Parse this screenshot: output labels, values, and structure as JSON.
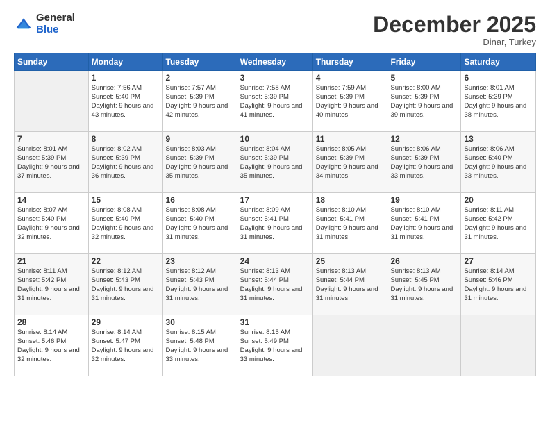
{
  "header": {
    "logo_general": "General",
    "logo_blue": "Blue",
    "month_title": "December 2025",
    "location": "Dinar, Turkey"
  },
  "weekdays": [
    "Sunday",
    "Monday",
    "Tuesday",
    "Wednesday",
    "Thursday",
    "Friday",
    "Saturday"
  ],
  "weeks": [
    [
      {
        "day": "",
        "sunrise": "",
        "sunset": "",
        "daylight": ""
      },
      {
        "day": "1",
        "sunrise": "7:56 AM",
        "sunset": "5:40 PM",
        "daylight": "9 hours and 43 minutes."
      },
      {
        "day": "2",
        "sunrise": "7:57 AM",
        "sunset": "5:39 PM",
        "daylight": "9 hours and 42 minutes."
      },
      {
        "day": "3",
        "sunrise": "7:58 AM",
        "sunset": "5:39 PM",
        "daylight": "9 hours and 41 minutes."
      },
      {
        "day": "4",
        "sunrise": "7:59 AM",
        "sunset": "5:39 PM",
        "daylight": "9 hours and 40 minutes."
      },
      {
        "day": "5",
        "sunrise": "8:00 AM",
        "sunset": "5:39 PM",
        "daylight": "9 hours and 39 minutes."
      },
      {
        "day": "6",
        "sunrise": "8:01 AM",
        "sunset": "5:39 PM",
        "daylight": "9 hours and 38 minutes."
      }
    ],
    [
      {
        "day": "7",
        "sunrise": "8:01 AM",
        "sunset": "5:39 PM",
        "daylight": "9 hours and 37 minutes."
      },
      {
        "day": "8",
        "sunrise": "8:02 AM",
        "sunset": "5:39 PM",
        "daylight": "9 hours and 36 minutes."
      },
      {
        "day": "9",
        "sunrise": "8:03 AM",
        "sunset": "5:39 PM",
        "daylight": "9 hours and 35 minutes."
      },
      {
        "day": "10",
        "sunrise": "8:04 AM",
        "sunset": "5:39 PM",
        "daylight": "9 hours and 35 minutes."
      },
      {
        "day": "11",
        "sunrise": "8:05 AM",
        "sunset": "5:39 PM",
        "daylight": "9 hours and 34 minutes."
      },
      {
        "day": "12",
        "sunrise": "8:06 AM",
        "sunset": "5:39 PM",
        "daylight": "9 hours and 33 minutes."
      },
      {
        "day": "13",
        "sunrise": "8:06 AM",
        "sunset": "5:40 PM",
        "daylight": "9 hours and 33 minutes."
      }
    ],
    [
      {
        "day": "14",
        "sunrise": "8:07 AM",
        "sunset": "5:40 PM",
        "daylight": "9 hours and 32 minutes."
      },
      {
        "day": "15",
        "sunrise": "8:08 AM",
        "sunset": "5:40 PM",
        "daylight": "9 hours and 32 minutes."
      },
      {
        "day": "16",
        "sunrise": "8:08 AM",
        "sunset": "5:40 PM",
        "daylight": "9 hours and 31 minutes."
      },
      {
        "day": "17",
        "sunrise": "8:09 AM",
        "sunset": "5:41 PM",
        "daylight": "9 hours and 31 minutes."
      },
      {
        "day": "18",
        "sunrise": "8:10 AM",
        "sunset": "5:41 PM",
        "daylight": "9 hours and 31 minutes."
      },
      {
        "day": "19",
        "sunrise": "8:10 AM",
        "sunset": "5:41 PM",
        "daylight": "9 hours and 31 minutes."
      },
      {
        "day": "20",
        "sunrise": "8:11 AM",
        "sunset": "5:42 PM",
        "daylight": "9 hours and 31 minutes."
      }
    ],
    [
      {
        "day": "21",
        "sunrise": "8:11 AM",
        "sunset": "5:42 PM",
        "daylight": "9 hours and 31 minutes."
      },
      {
        "day": "22",
        "sunrise": "8:12 AM",
        "sunset": "5:43 PM",
        "daylight": "9 hours and 31 minutes."
      },
      {
        "day": "23",
        "sunrise": "8:12 AM",
        "sunset": "5:43 PM",
        "daylight": "9 hours and 31 minutes."
      },
      {
        "day": "24",
        "sunrise": "8:13 AM",
        "sunset": "5:44 PM",
        "daylight": "9 hours and 31 minutes."
      },
      {
        "day": "25",
        "sunrise": "8:13 AM",
        "sunset": "5:44 PM",
        "daylight": "9 hours and 31 minutes."
      },
      {
        "day": "26",
        "sunrise": "8:13 AM",
        "sunset": "5:45 PM",
        "daylight": "9 hours and 31 minutes."
      },
      {
        "day": "27",
        "sunrise": "8:14 AM",
        "sunset": "5:46 PM",
        "daylight": "9 hours and 31 minutes."
      }
    ],
    [
      {
        "day": "28",
        "sunrise": "8:14 AM",
        "sunset": "5:46 PM",
        "daylight": "9 hours and 32 minutes."
      },
      {
        "day": "29",
        "sunrise": "8:14 AM",
        "sunset": "5:47 PM",
        "daylight": "9 hours and 32 minutes."
      },
      {
        "day": "30",
        "sunrise": "8:15 AM",
        "sunset": "5:48 PM",
        "daylight": "9 hours and 33 minutes."
      },
      {
        "day": "31",
        "sunrise": "8:15 AM",
        "sunset": "5:49 PM",
        "daylight": "9 hours and 33 minutes."
      },
      {
        "day": "",
        "sunrise": "",
        "sunset": "",
        "daylight": ""
      },
      {
        "day": "",
        "sunrise": "",
        "sunset": "",
        "daylight": ""
      },
      {
        "day": "",
        "sunrise": "",
        "sunset": "",
        "daylight": ""
      }
    ]
  ]
}
